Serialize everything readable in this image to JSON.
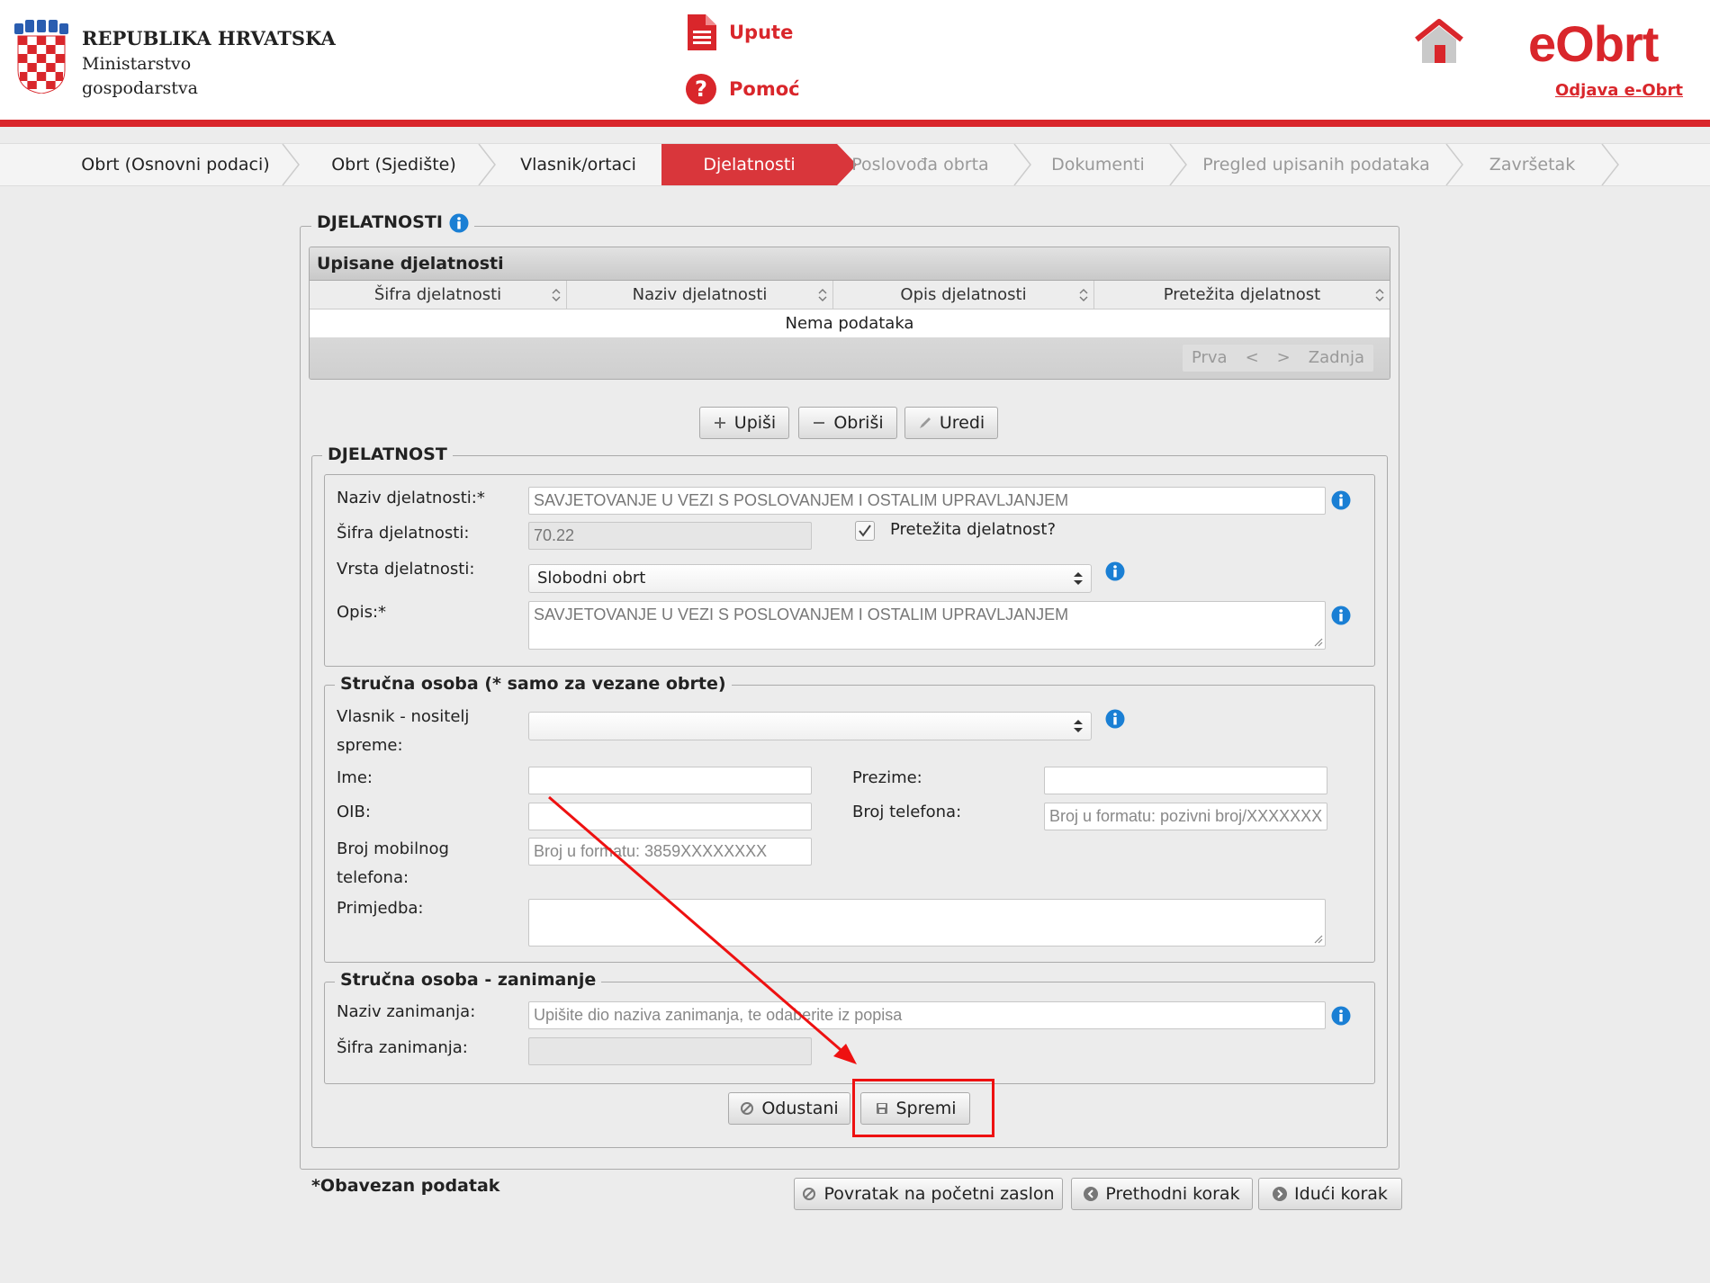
{
  "header": {
    "gov_title": "REPUBLIKA HRVATSKA",
    "gov_sub_line1": "Ministarstvo",
    "gov_sub_line2": "gospodarstva",
    "link_upute": "Upute",
    "link_pomoc": "Pomoć",
    "brand": "eObrt",
    "logout": "Odjava e-Obrt",
    "icons": [
      "croatian-coat-of-arms",
      "document-icon",
      "help-icon",
      "home-icon"
    ],
    "accent_color": "#d9262b"
  },
  "steps": [
    {
      "label": "Obrt (Osnovni podaci)",
      "state": "done"
    },
    {
      "label": "Obrt (Sjedište)",
      "state": "done"
    },
    {
      "label": "Vlasnik/ortaci",
      "state": "done"
    },
    {
      "label": "Djelatnosti",
      "state": "active"
    },
    {
      "label": "Poslovođa obrta",
      "state": "inactive"
    },
    {
      "label": "Dokumenti",
      "state": "inactive"
    },
    {
      "label": "Pregled upisanih podataka",
      "state": "inactive"
    },
    {
      "label": "Završetak",
      "state": "inactive"
    }
  ],
  "section": {
    "title": "DJELATNOSTI"
  },
  "grid": {
    "title": "Upisane djelatnosti",
    "columns": [
      "Šifra djelatnosti",
      "Naziv djelatnosti",
      "Opis djelatnosti",
      "Pretežita djelatnost"
    ],
    "empty_text": "Nema podataka",
    "pager": {
      "first": "Prva",
      "prev": "<",
      "next": ">",
      "last": "Zadnja"
    }
  },
  "grid_buttons": {
    "add": "Upiši",
    "delete": "Obriši",
    "edit": "Uredi"
  },
  "djelatnost": {
    "legend": "DJELATNOST",
    "naziv_label": "Naziv djelatnosti:*",
    "naziv_value": "SAVJETOVANJE U VEZI S POSLOVANJEM I OSTALIM UPRAVLJANJEM",
    "sifra_label": "Šifra djelatnosti:",
    "sifra_value": "70.22",
    "pretezita_label": "Pretežita djelatnost?",
    "pretezita_checked": true,
    "vrsta_label": "Vrsta djelatnosti:",
    "vrsta_value": "Slobodni obrt",
    "opis_label": "Opis:*",
    "opis_value": "SAVJETOVANJE U VEZI S POSLOVANJEM I OSTALIM UPRAVLJANJEM"
  },
  "strucna_osoba": {
    "legend": "Stručna osoba (* samo za vezane obrte)",
    "vlasnik_label_1": "Vlasnik - nositelj",
    "vlasnik_label_2": "spreme:",
    "vlasnik_value": "",
    "ime_label": "Ime:",
    "ime_value": "",
    "prezime_label": "Prezime:",
    "prezime_value": "",
    "oib_label": "OIB:",
    "oib_value": "",
    "telefon_label": "Broj telefona:",
    "telefon_placeholder": "Broj u formatu: pozivni broj/XXXXXXX",
    "mobitel_label_1": "Broj mobilnog",
    "mobitel_label_2": "telefona:",
    "mobitel_placeholder": "Broj u formatu: 3859XXXXXXXX",
    "primjedba_label": "Primjedba:",
    "primjedba_value": ""
  },
  "zanimanje": {
    "legend": "Stručna osoba - zanimanje",
    "naziv_label": "Naziv zanimanja:",
    "naziv_placeholder": "Upišite dio naziva zanimanja, te odaberite iz popisa",
    "sifra_label": "Šifra zanimanja:",
    "sifra_value": ""
  },
  "form_buttons": {
    "cancel": "Odustani",
    "save": "Spremi"
  },
  "footer": {
    "required_note": "*Obavezan podatak",
    "back_home": "Povratak na početni zaslon",
    "prev_step": "Prethodni korak",
    "next_step": "Idući korak"
  },
  "annotation": {
    "highlight_color": "#ee1111"
  }
}
